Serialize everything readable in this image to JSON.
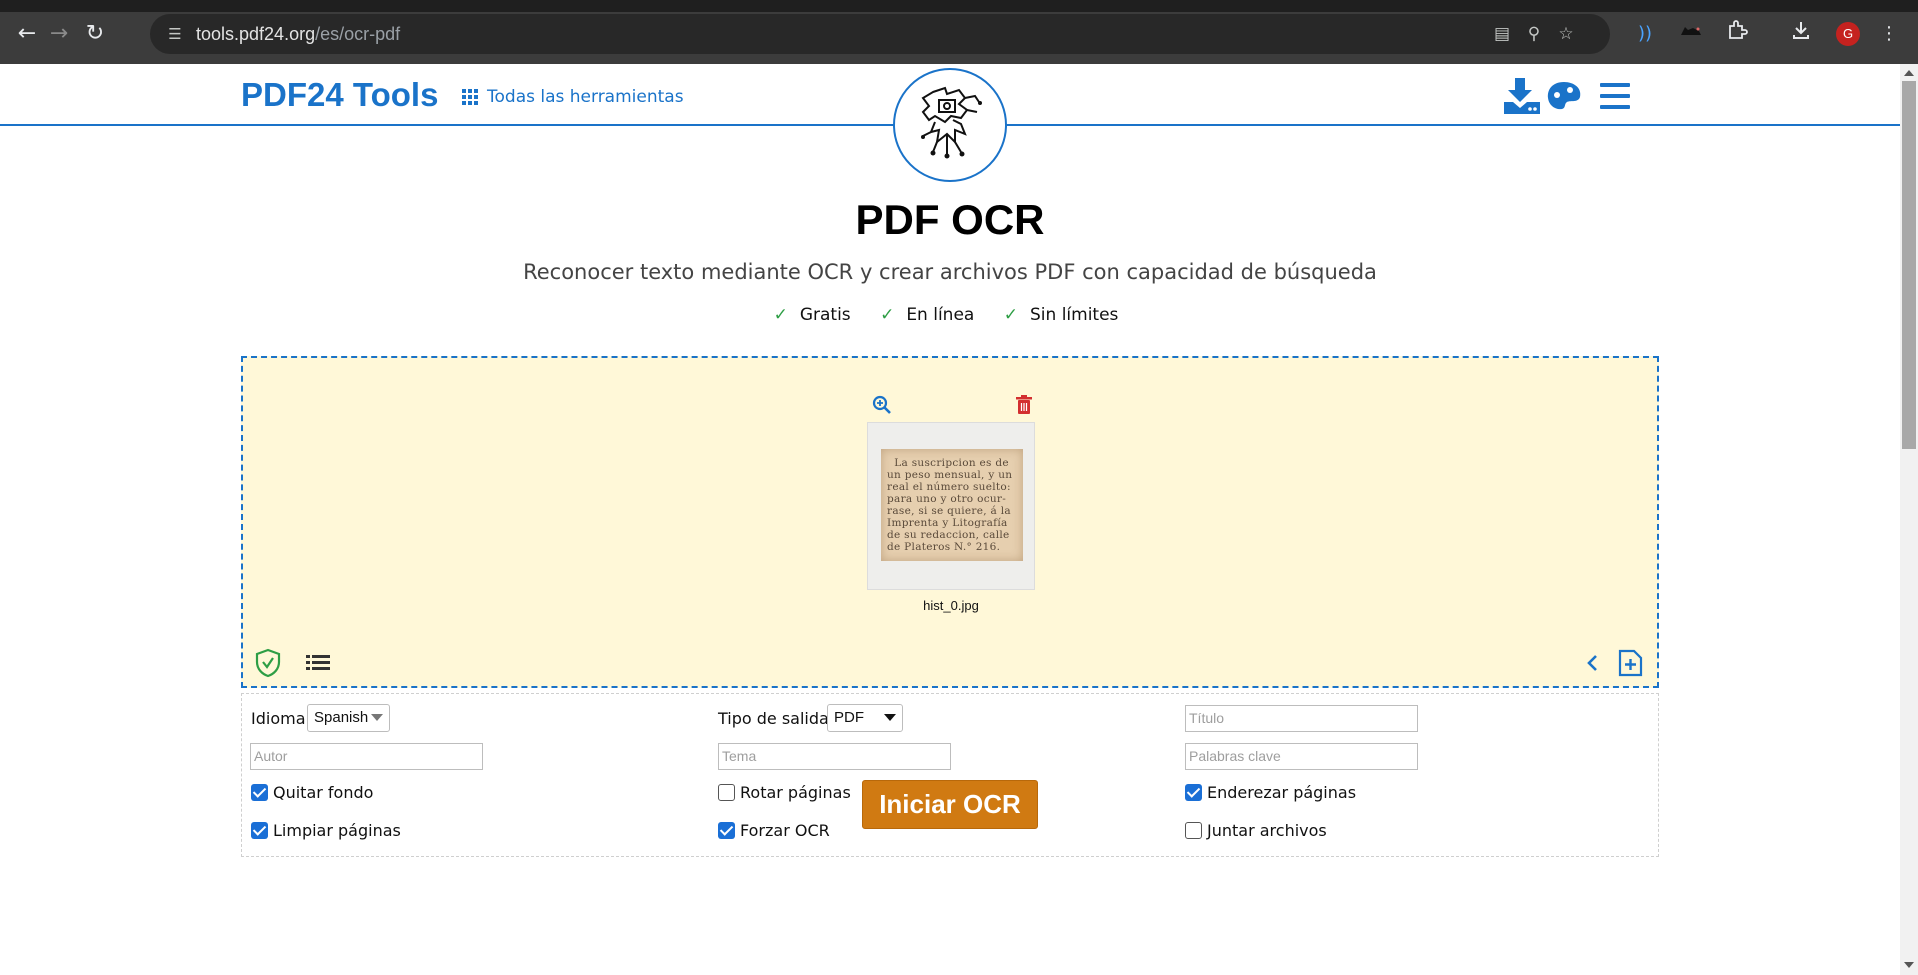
{
  "browser": {
    "url_host": "tools.pdf24.org",
    "url_path": "/es/ocr-pdf",
    "profile_initial": "G"
  },
  "header": {
    "brand": "PDF24 Tools",
    "all_tools_label": "Todas las herramientas",
    "accent_color": "#1a73c9"
  },
  "hero": {
    "title": "PDF OCR",
    "subtitle": "Reconocer texto mediante OCR y crear archivos PDF con capacidad de búsqueda",
    "features": [
      "Gratis",
      "En línea",
      "Sin límites"
    ],
    "check_mark": "✓"
  },
  "file": {
    "name": "hist_0.jpg",
    "preview_text": "  La suscripcion es de\nun peso mensual, y un\nreal el número suelto:\npara uno y otro ocur-\nrase, si se quiere, á la\nImprenta y Litografía\nde su redaccion, calle\nde Plateros N.° 216."
  },
  "options": {
    "language_label": "Idioma",
    "language_value": "Spanish",
    "output_type_label": "Tipo de salida",
    "output_type_value": "PDF",
    "title_placeholder": "Título",
    "author_placeholder": "Autor",
    "subject_placeholder": "Tema",
    "keywords_placeholder": "Palabras clave",
    "checkboxes": [
      {
        "label": "Quitar fondo",
        "checked": true
      },
      {
        "label": "Rotar páginas",
        "checked": false
      },
      {
        "label": "Enderezar páginas",
        "checked": true
      },
      {
        "label": "Limpiar páginas",
        "checked": true
      },
      {
        "label": "Forzar OCR",
        "checked": true
      },
      {
        "label": "Juntar archivos",
        "checked": false
      }
    ]
  },
  "actions": {
    "start_label": "Iniciar OCR",
    "start_color": "#d07a12"
  }
}
